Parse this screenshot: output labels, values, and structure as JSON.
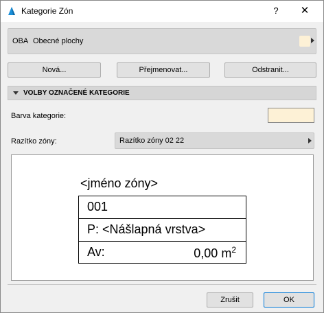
{
  "window": {
    "title": "Kategorie Zón",
    "help_label": "?",
    "close_label": "✕"
  },
  "category": {
    "code": "OBA",
    "name": "Obecné plochy",
    "color": "#fdf1d6"
  },
  "buttons": {
    "new": "Nová...",
    "rename": "Přejmenovat...",
    "delete": "Odstranit..."
  },
  "section": {
    "title": "VOLBY OZNAČENÉ KATEGORIE"
  },
  "fields": {
    "color_label": "Barva kategorie:",
    "color_value": "#fdf1d6",
    "stamp_label": "Razítko zóny:",
    "stamp_value": "Razítko zóny 02 22"
  },
  "preview": {
    "name": "<jméno zóny>",
    "number": "001",
    "floor": "P: <Nášlapná vrstva>",
    "area_label": "Av:",
    "area_value": "0,00 m",
    "area_sup": "2"
  },
  "footer": {
    "cancel": "Zrušit",
    "ok": "OK"
  },
  "icons": {
    "app": "archicad-logo-icon",
    "dropdown": "chevron-right-icon"
  }
}
